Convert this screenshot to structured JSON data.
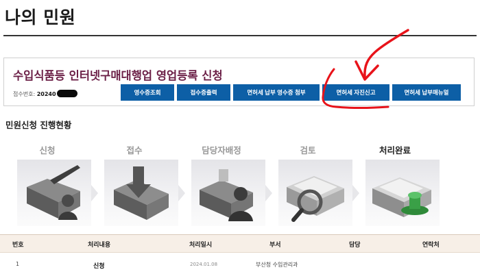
{
  "page": {
    "title": "나의 민원"
  },
  "application": {
    "name": "수입식품등 인터넷구매대행업 영업등록 신청",
    "receipt_label": "접수번호:",
    "receipt_number_visible": "20240"
  },
  "buttons": {
    "receipt_view": "영수증조회",
    "receipt_print": "접수증출력",
    "license_tax_attach": "면허세 납부 영수증 첨부",
    "license_tax_self_report": "면허세 자진신고",
    "license_tax_manual": "면허세 납부매뉴얼"
  },
  "progress": {
    "section_title": "민원신청 진행현황",
    "steps": [
      {
        "label": "신청",
        "icon": "application-folder-pen-icon",
        "current": false
      },
      {
        "label": "접수",
        "icon": "receipt-folder-arrow-icon",
        "current": false
      },
      {
        "label": "담당자배정",
        "icon": "assign-folder-person-icon",
        "current": false
      },
      {
        "label": "검토",
        "icon": "review-documents-magnifier-icon",
        "current": false
      },
      {
        "label": "처리완료",
        "icon": "complete-documents-stamp-icon",
        "current": true
      }
    ]
  },
  "table": {
    "headers": [
      "번호",
      "처리내용",
      "처리일시",
      "부서",
      "담당",
      "연락처"
    ],
    "rows": [
      {
        "no": "1",
        "content": "신청",
        "datetime": "2024.01.08",
        "department": "부산청 수입관리과",
        "manager": "",
        "contact": ""
      }
    ]
  },
  "colors": {
    "app_title": "#6b1f46",
    "button_bg": "#0d5fa6",
    "annotation_red": "#e8131a",
    "table_head_bg": "#f7efe7"
  }
}
